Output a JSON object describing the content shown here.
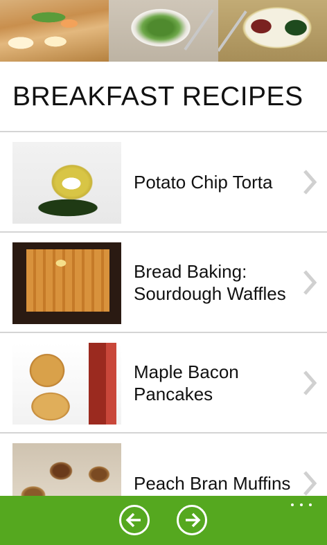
{
  "page": {
    "title": "BREAKFAST RECIPES"
  },
  "recipes": [
    {
      "title": "Potato Chip Torta",
      "thumb_icon": "tortilla-photo"
    },
    {
      "title": "Bread Baking: Sourdough Waffles",
      "thumb_icon": "waffles-photo"
    },
    {
      "title": "Maple Bacon Pancakes",
      "thumb_icon": "pancakes-bacon-photo"
    },
    {
      "title": "Peach Bran Muffins",
      "thumb_icon": "muffins-photo"
    }
  ],
  "app_bar": {
    "back_icon": "arrow-left-icon",
    "forward_icon": "arrow-right-icon",
    "more_icon": "more-ellipsis-icon",
    "accent_color": "#55a81f"
  }
}
